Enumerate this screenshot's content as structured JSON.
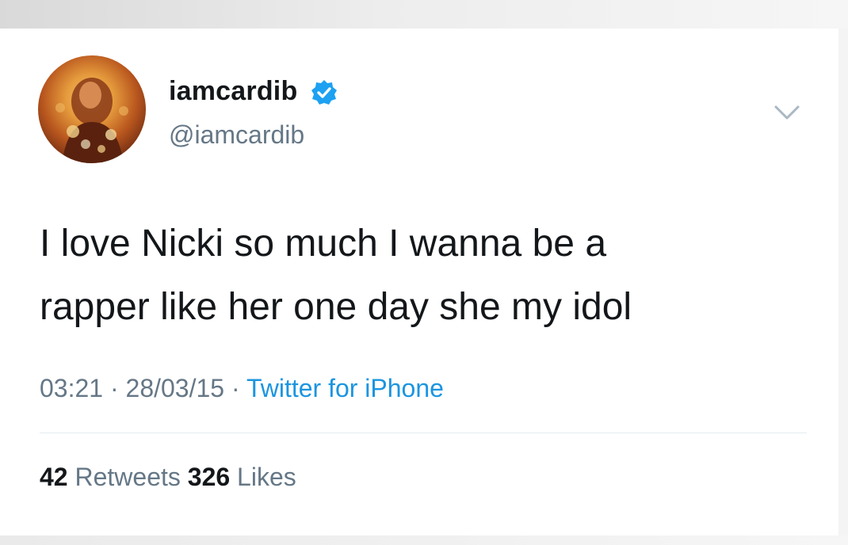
{
  "author": {
    "display_name": "iamcardib",
    "handle": "@iamcardib",
    "verified_icon": "verified-badge-icon",
    "avatar": "profile-photo"
  },
  "tweet": {
    "lines": [
      "I love Nicki so much I wanna be a",
      "rapper like her one day she my idol"
    ],
    "time": "03:21",
    "date": "28/03/15",
    "separator": "·",
    "source": "Twitter for iPhone"
  },
  "stats": {
    "retweets_count": "42",
    "retweets_label": "Retweets",
    "likes_count": "326",
    "likes_label": "Likes"
  },
  "menu_icon": "chevron-down-icon",
  "colors": {
    "text": "#14171a",
    "secondary": "#657786",
    "link": "#1b95e0",
    "verified": "#1da1f2"
  }
}
